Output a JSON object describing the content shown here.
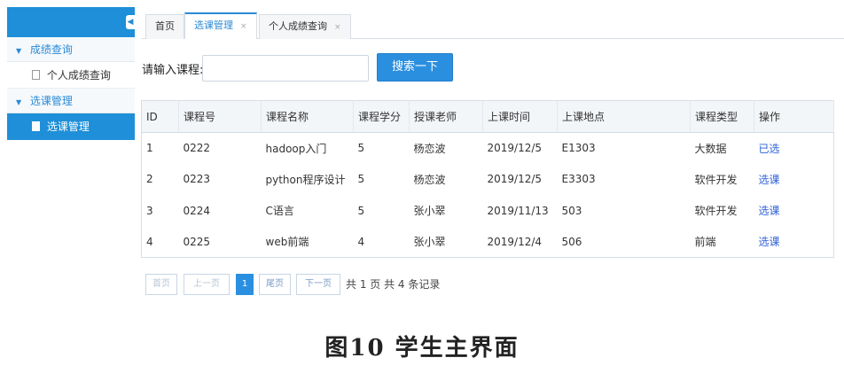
{
  "sidebar": {
    "groups": [
      {
        "label": "成绩查询",
        "items": [
          {
            "label": "个人成绩查询"
          }
        ]
      },
      {
        "label": "选课管理",
        "items": [
          {
            "label": "选课管理"
          }
        ]
      }
    ]
  },
  "tabs": [
    {
      "label": "首页"
    },
    {
      "label": "选课管理",
      "close": "×"
    },
    {
      "label": "个人成绩查询",
      "close": "×"
    }
  ],
  "search": {
    "label": "请输入课程:",
    "value": "",
    "button": "搜索一下"
  },
  "table": {
    "columns": [
      "ID",
      "课程号",
      "课程名称",
      "课程学分",
      "授课老师",
      "上课时间",
      "上课地点",
      "课程类型",
      "操作"
    ],
    "rows": [
      [
        "1",
        "0222",
        "hadoop入门",
        "5",
        "杨恋波",
        "2019/12/5",
        "E1303",
        "大数据",
        "已选"
      ],
      [
        "2",
        "0223",
        "python程序设计",
        "5",
        "杨恋波",
        "2019/12/5",
        "E3303",
        "软件开发",
        "选课"
      ],
      [
        "3",
        "0224",
        "C语言",
        "5",
        "张小翠",
        "2019/11/13",
        "503",
        "软件开发",
        "选课"
      ],
      [
        "4",
        "0225",
        "web前端",
        "4",
        "张小翠",
        "2019/12/4",
        "506",
        "前端",
        "选课"
      ]
    ]
  },
  "pagination": {
    "first": "首页",
    "prev": "上一页",
    "current": "1",
    "last": "尾页",
    "next": "下一页",
    "summary": "共 1 页 共 4 条记录"
  },
  "caption": "图10   学生主界面",
  "colors": {
    "accent": "#1e8fd8",
    "link": "#2b5fd9"
  }
}
